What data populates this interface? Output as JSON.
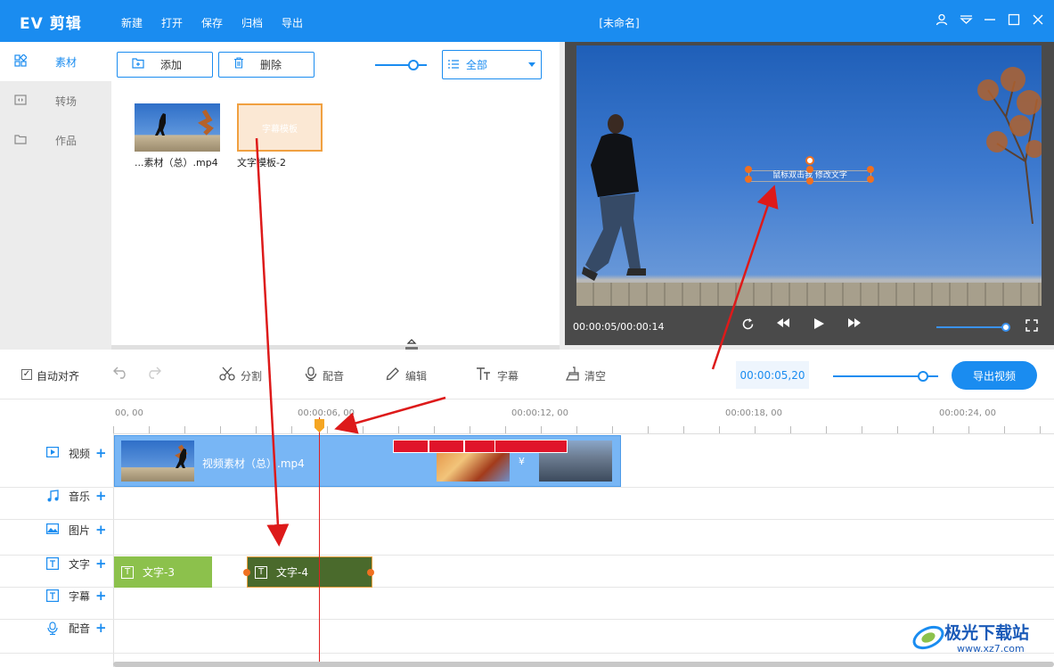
{
  "app": {
    "logo": "EV 剪辑",
    "doc_title": "[未命名]",
    "menu": [
      "新建",
      "打开",
      "保存",
      "归档",
      "导出"
    ]
  },
  "sidebar": {
    "items": [
      {
        "label": "素材",
        "icon": "grid-icon",
        "active": true
      },
      {
        "label": "转场",
        "icon": "transition-icon",
        "active": false
      },
      {
        "label": "作品",
        "icon": "folder-icon",
        "active": false
      }
    ]
  },
  "media": {
    "add_label": "添加",
    "delete_label": "删除",
    "filter_value": "全部",
    "items": [
      {
        "caption": "...素材（总）.mp4"
      },
      {
        "caption": "文字模板-2",
        "overlay": "字幕模板"
      }
    ]
  },
  "preview": {
    "overlay_text": "鼠标双击我 修改文字",
    "time": "00:00:05/00:00:14"
  },
  "toolbar": {
    "auto_align_label": "自动对齐",
    "tools": [
      "分割",
      "配音",
      "编辑",
      "字幕",
      "清空"
    ],
    "current_time": "00:00:05,20",
    "export_label": "导出视频"
  },
  "timeline": {
    "ruler_labels": [
      "00, 00",
      "00:00:06, 00",
      "00:00:12, 00",
      "00:00:18, 00",
      "00:00:24, 00"
    ],
    "tracks": [
      "视频",
      "音乐",
      "图片",
      "文字",
      "字幕",
      "配音"
    ],
    "video_clip_label": "视频素材（总）.mp4",
    "video_clip_tag": "¥",
    "text_clips": [
      "文字-3",
      "文字-4"
    ]
  },
  "watermark": {
    "name": "极光下载站",
    "url": "www.xz7.com"
  },
  "colors": {
    "primary": "#1a8cf0",
    "text_clip_light": "#8cc14c",
    "text_clip_dark": "#4a6a2c",
    "handle": "#f07020",
    "playhead": "#e02020"
  }
}
